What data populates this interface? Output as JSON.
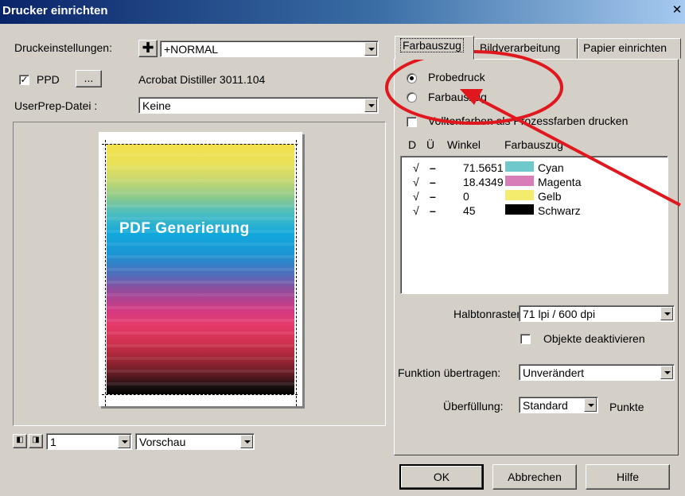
{
  "window": {
    "title": "Drucker einrichten"
  },
  "left": {
    "druckeinstellungen_label": "Druckeinstellungen:",
    "druckeinstellungen_value": "+NORMAL",
    "ppd_label": "PPD",
    "ppd_browse": "...",
    "ppd_checked": true,
    "ppd_name": "Acrobat Distiller 3011.104",
    "userprep_label": "UserPrep-Datei :",
    "userprep_value": "Keine",
    "preview_text": "PDF Generierung",
    "page_value": "1",
    "view_value": "Vorschau"
  },
  "tabs": [
    {
      "label": "Farbauszug",
      "active": true
    },
    {
      "label": "Bildverarbeitung",
      "active": false
    },
    {
      "label": "Papier einrichten",
      "active": false
    }
  ],
  "farbauszug": {
    "radio_probedruck": "Probedruck",
    "radio_farbauszug": "Farbauszug",
    "selected": "Probedruck",
    "vollton_label": "Volltonfarben als Prozessfarben drucken",
    "col_d": "D",
    "col_u": "Ü",
    "col_winkel": "Winkel",
    "col_farbauszug": "Farbauszug",
    "rows": [
      {
        "d": "√",
        "u": "–",
        "winkel": "71.5651",
        "name": "Cyan",
        "color": "#6ec8cc"
      },
      {
        "d": "√",
        "u": "–",
        "winkel": "18.4349",
        "name": "Magenta",
        "color": "#d97db8"
      },
      {
        "d": "√",
        "u": "–",
        "winkel": "0",
        "name": "Gelb",
        "color": "#f4ec6c"
      },
      {
        "d": "√",
        "u": "–",
        "winkel": "45",
        "name": "Schwarz",
        "color": "#000000"
      }
    ],
    "halbton_label": "Halbtonraster:",
    "halbton_value": "71 lpi / 600 dpi",
    "objekte_label": "Objekte deaktivieren",
    "funktion_label": "Funktion übertragen:",
    "funktion_value": "Unverändert",
    "ueberfuellung_label": "Überfüllung:",
    "ueberfuellung_value": "Standard",
    "punkte_label": "Punkte"
  },
  "buttons": {
    "ok": "OK",
    "abbrechen": "Abbrechen",
    "hilfe": "Hilfe"
  },
  "annotation_color": "#e0181e"
}
